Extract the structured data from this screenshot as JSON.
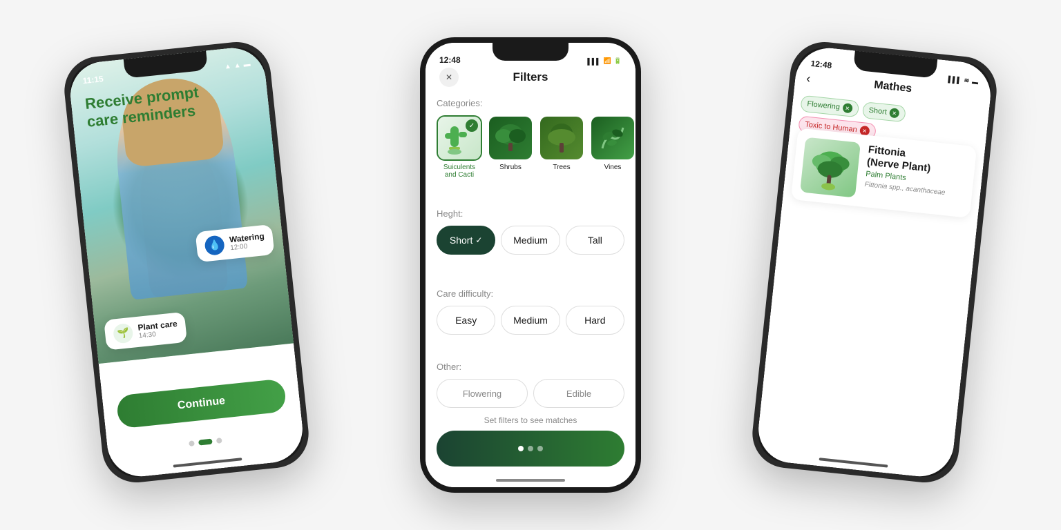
{
  "background_color": "#f0f0f0",
  "phones": {
    "left": {
      "status_time": "11:15",
      "title_line1": "Receive prompt",
      "title_line2": "care reminders",
      "watering_card": {
        "icon": "💧",
        "title": "Watering",
        "time": "12:00"
      },
      "plant_care_card": {
        "icon": "🌱",
        "title": "Plant care",
        "time": "14:30"
      },
      "continue_btn": "Continue",
      "dots": [
        "inactive",
        "active",
        "inactive"
      ]
    },
    "center": {
      "status_time": "12:48",
      "title": "Filters",
      "close_icon": "✕",
      "categories_label": "Categories:",
      "categories": [
        {
          "label": "Suiculents\nand Cacti",
          "selected": true
        },
        {
          "label": "Shrubs",
          "selected": false
        },
        {
          "label": "Trees",
          "selected": false
        },
        {
          "label": "Vines",
          "selected": false
        }
      ],
      "height_label": "Heght:",
      "height_options": [
        {
          "label": "Short",
          "active": true
        },
        {
          "label": "Medium",
          "active": false
        },
        {
          "label": "Tall",
          "active": false
        }
      ],
      "difficulty_label": "Care difficulty:",
      "difficulty_options": [
        {
          "label": "Easy",
          "active": false
        },
        {
          "label": "Medium",
          "active": false
        },
        {
          "label": "Hard",
          "active": false
        }
      ],
      "other_label": "Other:",
      "other_options": [
        {
          "label": "Flowering"
        },
        {
          "label": "Edible"
        }
      ],
      "set_filters_msg": "Set filters to see matches",
      "dots": [
        "active",
        "inactive",
        "inactive"
      ]
    },
    "right": {
      "status_time": "12:48",
      "back_icon": "‹",
      "title": "Mathes",
      "tags": [
        {
          "label": "Flowering",
          "type": "green"
        },
        {
          "label": "Short",
          "type": "green"
        },
        {
          "label": "Toxic to Human",
          "type": "red"
        }
      ],
      "plant": {
        "name": "Fittonia\n(Nerve Plant)",
        "category": "Palm Plants",
        "scientific": "Fittonia spp., acanthaceae",
        "emoji": "🌿"
      }
    }
  }
}
